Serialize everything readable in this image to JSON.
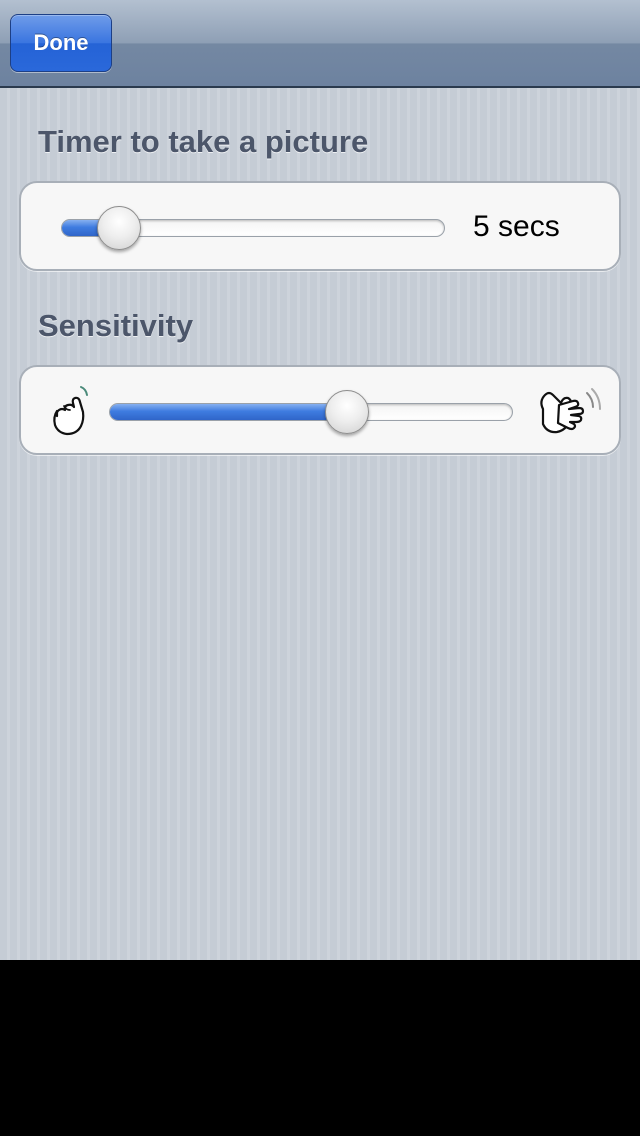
{
  "nav": {
    "done_label": "Done"
  },
  "timer": {
    "title": "Timer to take a picture",
    "value_label": "5 secs",
    "slider_fraction": 0.15
  },
  "sensitivity": {
    "title": "Sensitivity",
    "slider_fraction": 0.59,
    "min_icon": "quiet-hand-tap-icon",
    "max_icon": "loud-hand-clap-icon"
  },
  "colors": {
    "accent": "#3a75e0",
    "nav_bar": "#8e9fb5",
    "title_text": "#4c566a"
  }
}
